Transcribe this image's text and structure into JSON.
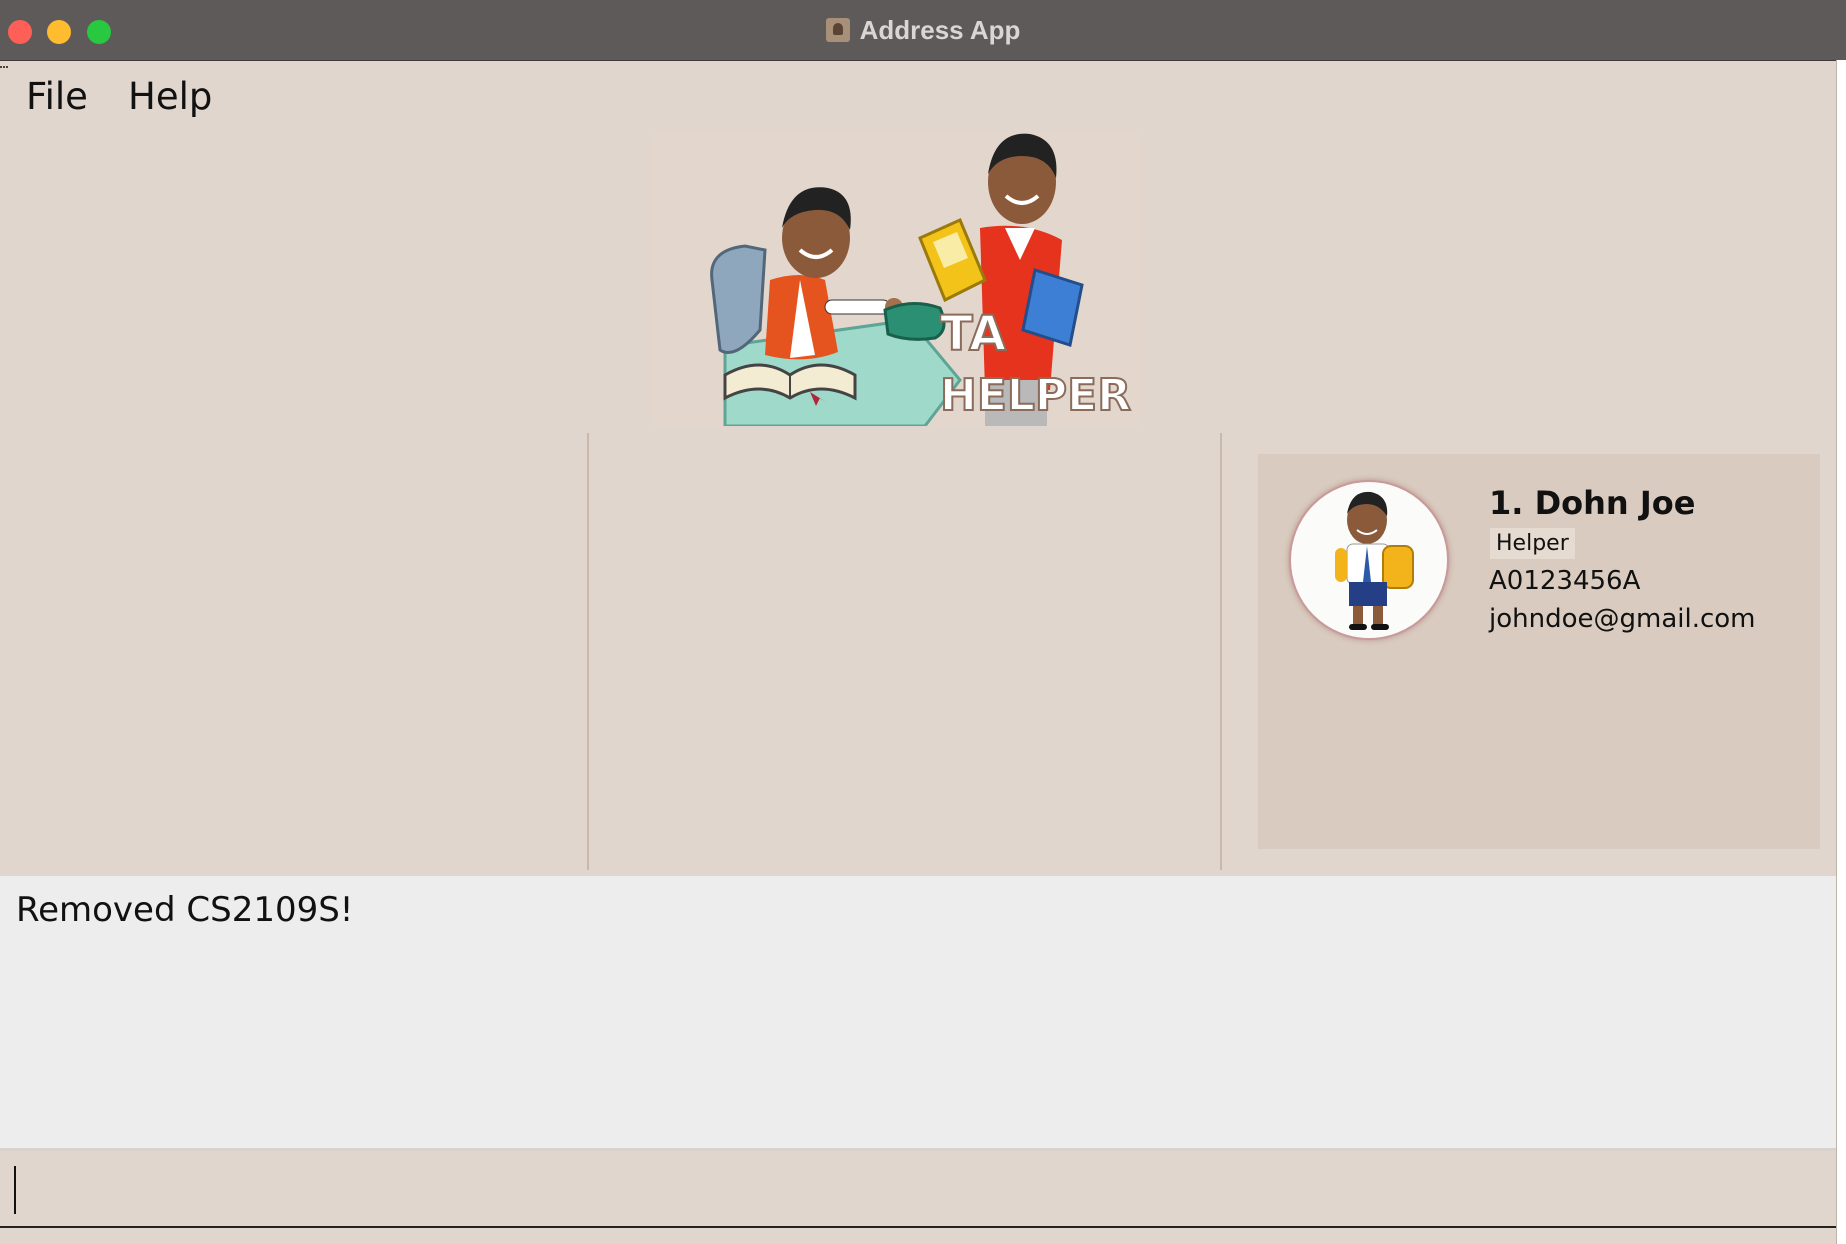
{
  "window": {
    "title": "Address App",
    "title_icon": "address-book-icon",
    "buttons": [
      "close",
      "minimize",
      "maximize"
    ]
  },
  "menu": {
    "file_label": "File",
    "help_label": "Help"
  },
  "banner": {
    "logo_text_line1": "TA",
    "logo_text_line2": "HELPER"
  },
  "person_card": {
    "index": "1.",
    "name": "Dohn Joe",
    "tag": "Helper",
    "id": "A0123456A",
    "email": "johndoe@gmail.com",
    "avatar_icon": "student-avatar-icon"
  },
  "result_display": {
    "message": "Removed CS2109S!"
  },
  "command_box": {
    "value": "",
    "placeholder": ""
  },
  "colors": {
    "background": "#e1d6cd",
    "titlebar": "#5e5a59",
    "card_background": "#d9cbbf",
    "result_background": "#ededed"
  }
}
